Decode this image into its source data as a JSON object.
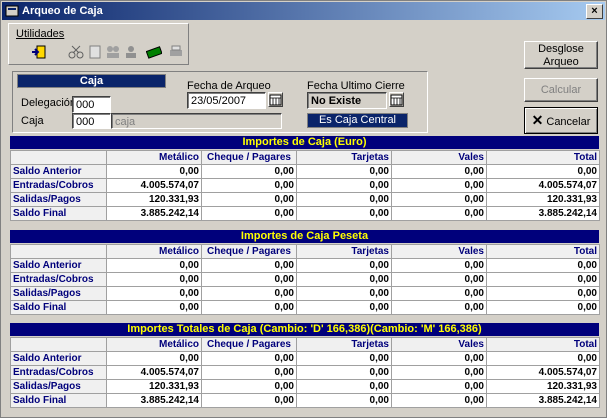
{
  "window": {
    "title": "Arqueo de Caja",
    "close": "×"
  },
  "menu": {
    "utilidades": "Utilidades"
  },
  "toolbar": {
    "icons": [
      "import-icon",
      "scissors-icon",
      "binoculars-icon",
      "page-icon",
      "users-icon",
      "money-icon",
      "print-icon"
    ]
  },
  "buttons": {
    "desglose_line1": "Desglose",
    "desglose_line2": "Arqueo",
    "calcular": "Calcular Arqueo",
    "cancelar": "Cancelar"
  },
  "caja_panel": {
    "header": "Caja",
    "delegacion_label": "Delegación",
    "delegacion_value": "000",
    "caja_label": "Caja",
    "caja_value": "000",
    "caja_name": "caja",
    "fecha_arqueo_label": "Fecha de Arqueo",
    "fecha_arqueo_value": "23/05/2007",
    "fecha_cierre_label": "Fecha Ultimo Cierre",
    "fecha_cierre_value": "No Existe",
    "central_badge": "Es Caja Central"
  },
  "columns": [
    "Metálico",
    "Cheque / Pagares",
    "Tarjetas",
    "Vales",
    "Total"
  ],
  "row_labels": [
    "Saldo Anterior",
    "Entradas/Cobros",
    "Salidas/Pagos",
    "Saldo Final"
  ],
  "sections": [
    {
      "title": "Importes de Caja (Euro)",
      "rows": [
        [
          "0,00",
          "0,00",
          "0,00",
          "0,00",
          "0,00"
        ],
        [
          "4.005.574,07",
          "0,00",
          "0,00",
          "0,00",
          "4.005.574,07"
        ],
        [
          "120.331,93",
          "0,00",
          "0,00",
          "0,00",
          "120.331,93"
        ],
        [
          "3.885.242,14",
          "0,00",
          "0,00",
          "0,00",
          "3.885.242,14"
        ]
      ]
    },
    {
      "title": "Importes de Caja  Peseta",
      "rows": [
        [
          "0,00",
          "0,00",
          "0,00",
          "0,00",
          "0,00"
        ],
        [
          "0,00",
          "0,00",
          "0,00",
          "0,00",
          "0,00"
        ],
        [
          "0,00",
          "0,00",
          "0,00",
          "0,00",
          "0,00"
        ],
        [
          "0,00",
          "0,00",
          "0,00",
          "0,00",
          "0,00"
        ]
      ]
    },
    {
      "title": "Importes Totales de Caja (Cambio: 'D' 166,386)(Cambio: 'M' 166,386)",
      "rows": [
        [
          "0,00",
          "0,00",
          "0,00",
          "0,00",
          "0,00"
        ],
        [
          "4.005.574,07",
          "0,00",
          "0,00",
          "0,00",
          "4.005.574,07"
        ],
        [
          "120.331,93",
          "0,00",
          "0,00",
          "0,00",
          "120.331,93"
        ],
        [
          "3.885.242,14",
          "0,00",
          "0,00",
          "0,00",
          "3.885.242,14"
        ]
      ]
    }
  ]
}
